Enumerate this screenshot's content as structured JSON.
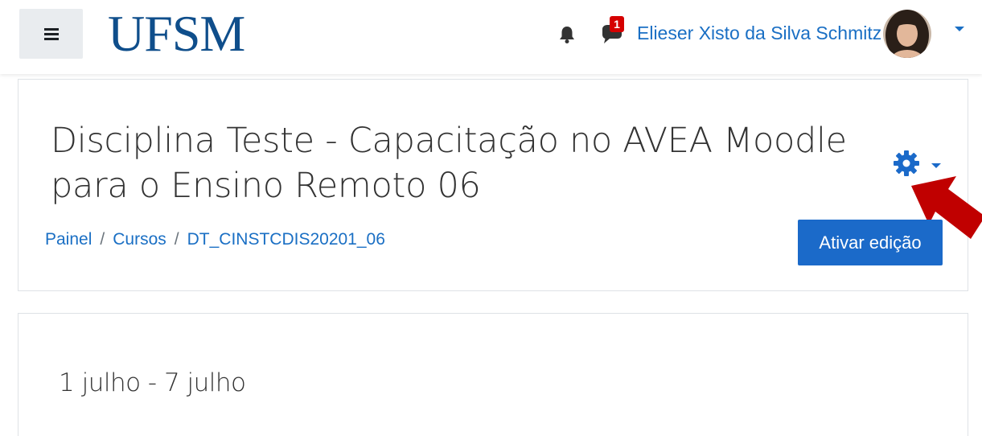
{
  "navbar": {
    "logo_text": "UFSM",
    "notification_badge": "1",
    "user_name": "Elieser Xisto da Silva Schmitz"
  },
  "course": {
    "title": "Disciplina Teste - Capacitação no AVEA Moodle para o Ensino Remoto 06",
    "edit_button_label": "Ativar edição",
    "breadcrumb": [
      {
        "label": "Painel"
      },
      {
        "label": "Cursos"
      },
      {
        "label": "DT_CINSTCDIS20201_06"
      }
    ]
  },
  "section": {
    "title": "1 julho - 7 julho"
  },
  "icons": {
    "menu": "hamburger-icon",
    "notifications": "bell-icon",
    "messages": "chat-bubble-icon",
    "settings": "gear-icon",
    "dropdown": "caret-down-icon"
  },
  "colors": {
    "brand": "#0f4e8b",
    "link": "#1a6fc4",
    "primary_button": "#1b6ac9",
    "badge": "#d50000",
    "annotation_arrow": "#c00000"
  }
}
